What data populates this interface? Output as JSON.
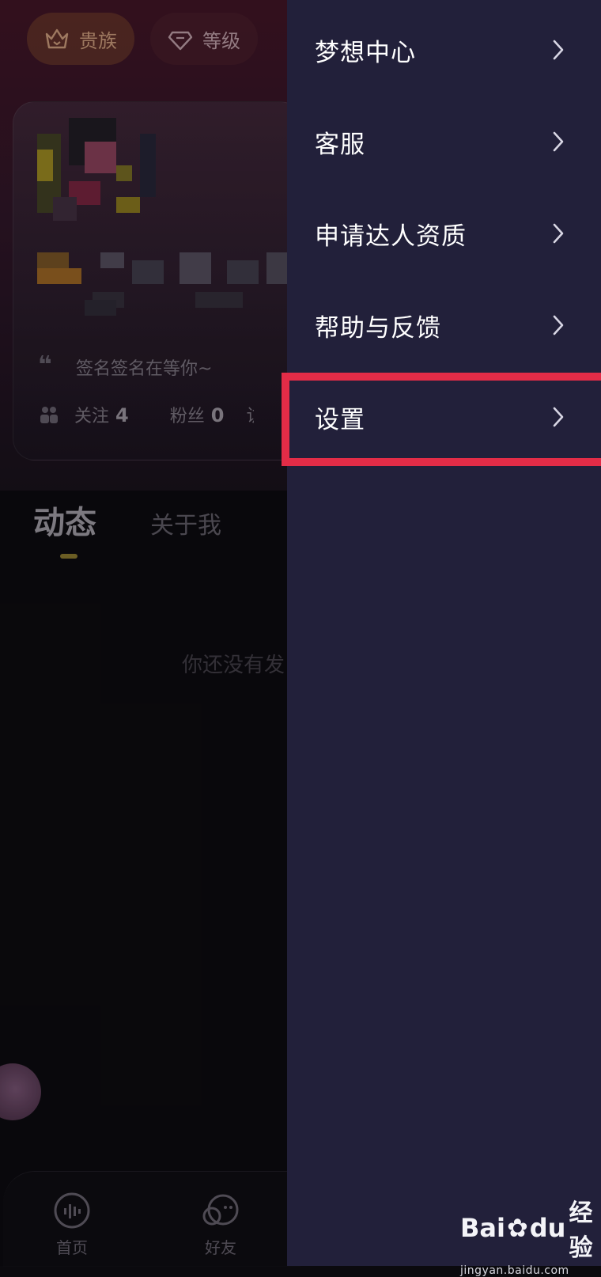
{
  "background": {
    "chips": {
      "noble_label": "贵族",
      "level_label": "等级"
    },
    "profile": {
      "signature": "签名签名在等你~",
      "following_label": "关注",
      "following_count": "4",
      "followers_label": "粉丝",
      "followers_count": "0",
      "trailing_label": "访"
    },
    "tabs": [
      {
        "label": "动态",
        "active": true
      },
      {
        "label": "关于我",
        "active": false
      }
    ],
    "empty_text": "你还没有发",
    "bottom_nav": [
      {
        "label": "首页",
        "icon": "home-waveform-icon"
      },
      {
        "label": "好友",
        "icon": "friends-icon"
      }
    ]
  },
  "drawer": {
    "items": [
      {
        "label": "梦想中心"
      },
      {
        "label": "客服"
      },
      {
        "label": "申请达人资质"
      },
      {
        "label": "帮助与反馈"
      },
      {
        "label": "设置",
        "highlighted": true
      }
    ],
    "highlight_color": "#e32c47",
    "background_color": "#22203a"
  },
  "watermark": {
    "logo_text": "Bai",
    "logo_text_2": "du",
    "logo_suffix": "经验",
    "url": "jingyan.baidu.com"
  }
}
